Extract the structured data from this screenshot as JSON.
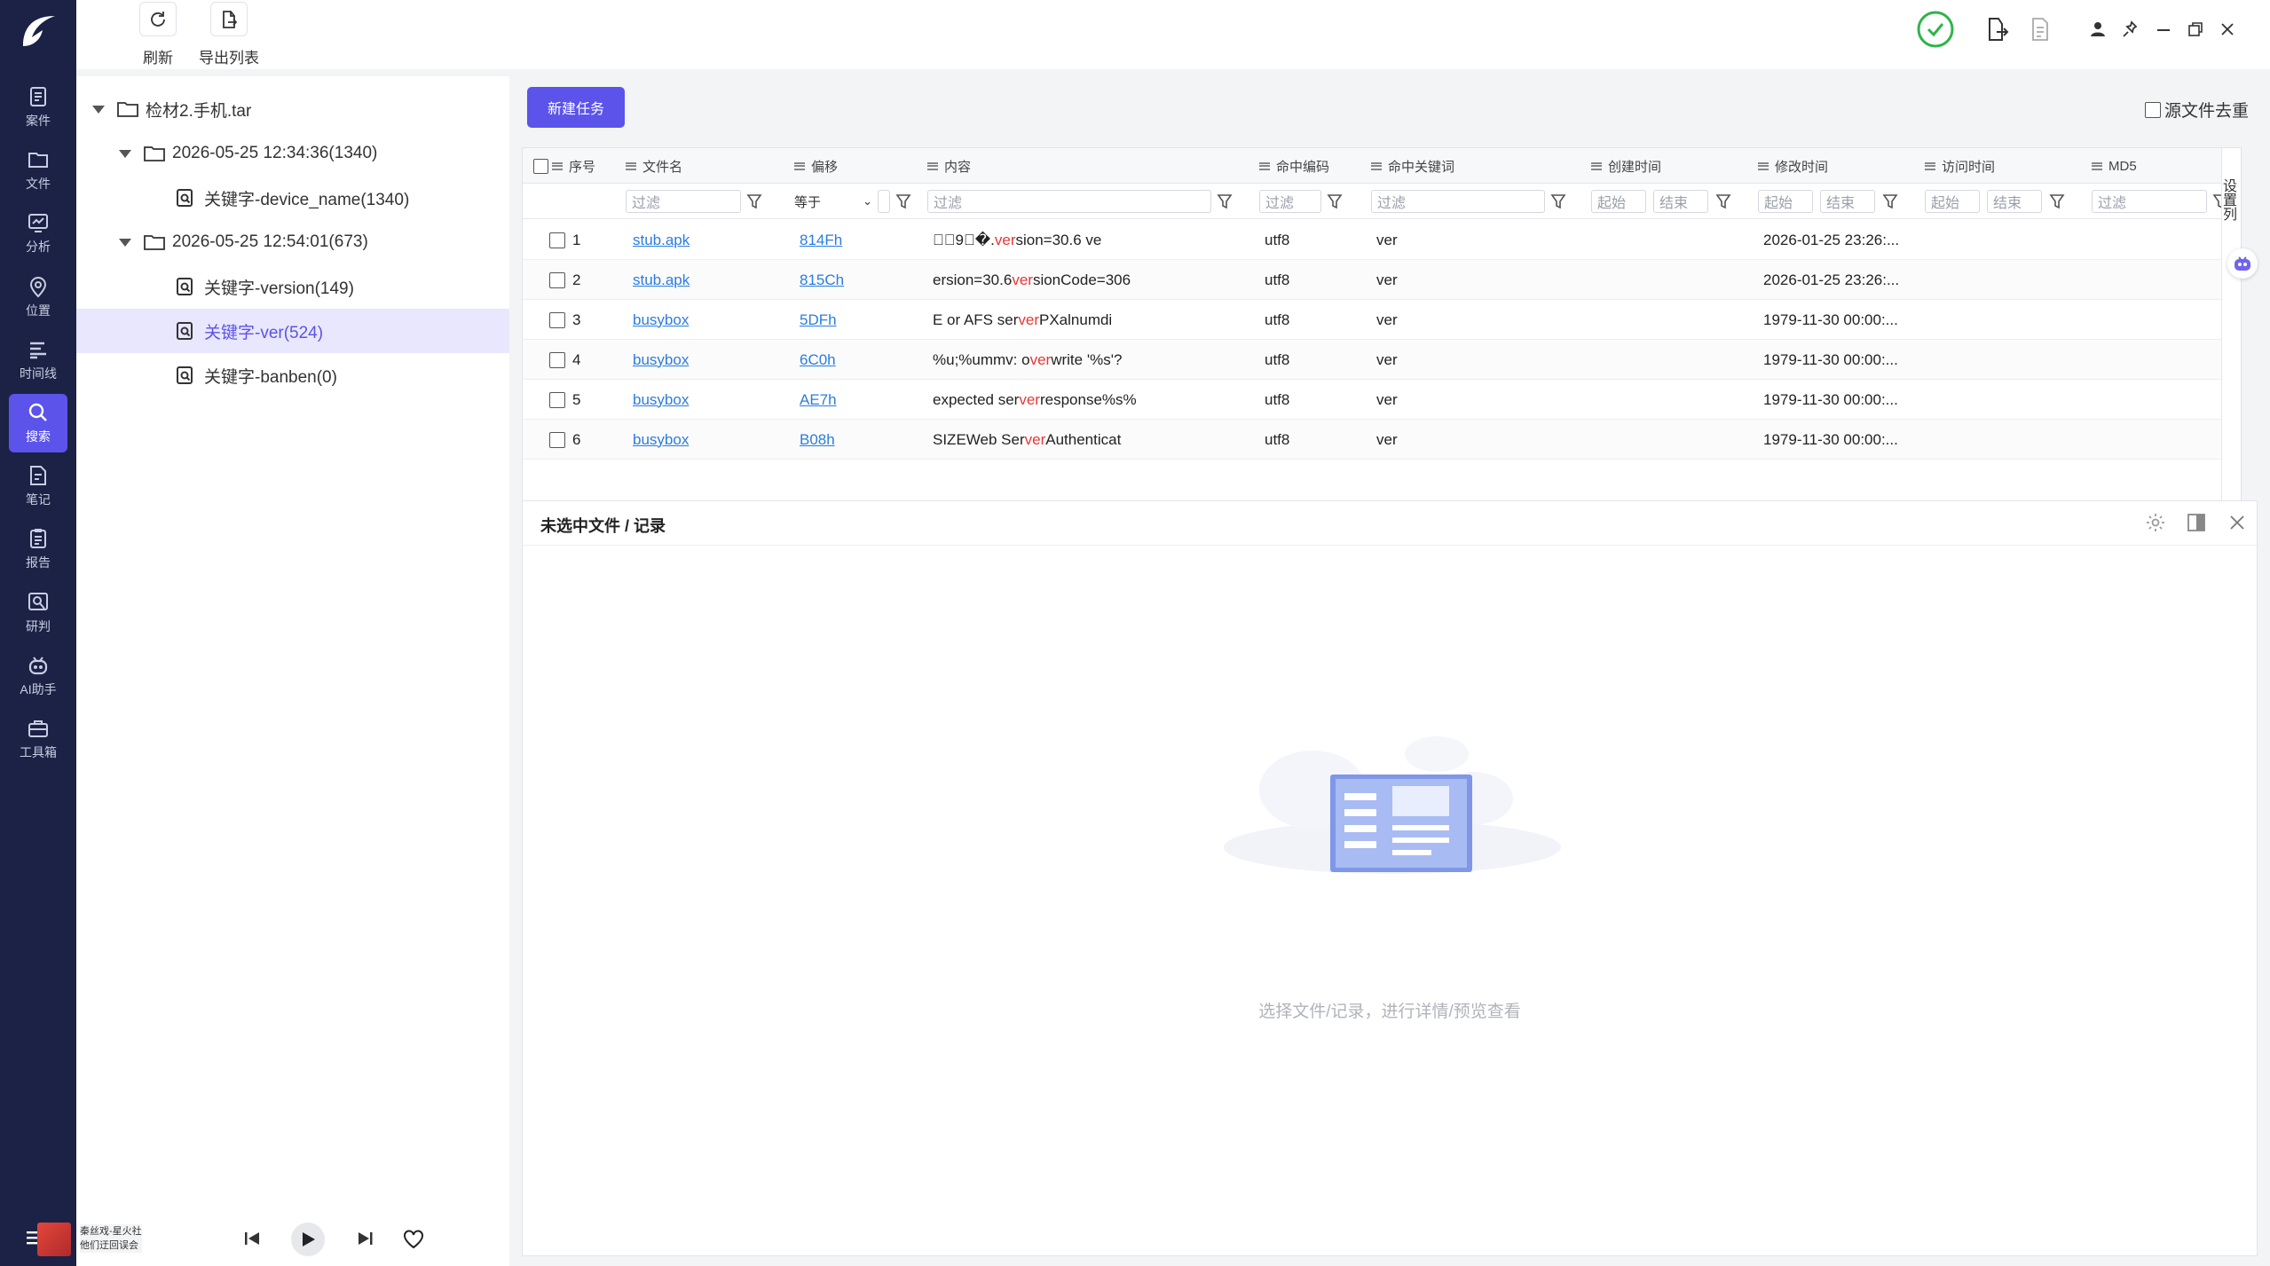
{
  "nav": {
    "items": [
      {
        "label": "案件",
        "icon": "case-icon"
      },
      {
        "label": "文件",
        "icon": "folder-icon"
      },
      {
        "label": "分析",
        "icon": "analysis-icon"
      },
      {
        "label": "位置",
        "icon": "location-pin-icon"
      },
      {
        "label": "时间线",
        "icon": "timeline-icon"
      },
      {
        "label": "搜索",
        "icon": "search-icon"
      },
      {
        "label": "笔记",
        "icon": "note-icon"
      },
      {
        "label": "报告",
        "icon": "report-icon"
      },
      {
        "label": "研判",
        "icon": "judgement-icon"
      },
      {
        "label": "AI助手",
        "icon": "ai-robot-icon"
      },
      {
        "label": "工具箱",
        "icon": "toolbox-icon"
      }
    ],
    "active": "搜索",
    "accent": "#5b53ea"
  },
  "toolbar": {
    "refresh_label": "刷新",
    "export_label": "导出列表"
  },
  "tree": {
    "root": "检材2.手机.tar",
    "nodes": [
      {
        "label": "2026-05-25 12:34:36(1340)"
      },
      {
        "label": "关键字-device_name(1340)"
      },
      {
        "label": "2026-05-25 12:54:01(673)"
      },
      {
        "label": "关键字-version(149)"
      },
      {
        "label": "关键字-ver(524)"
      },
      {
        "label": "关键字-banben(0)"
      }
    ]
  },
  "music": {
    "line1": "秦丝戏-星火社",
    "line2": "他们迂回误会"
  },
  "main": {
    "new_task_label": "新建任务",
    "dedup_label": "源文件去重",
    "columns": [
      "序号",
      "文件名",
      "偏移",
      "内容",
      "命中编码",
      "命中关键词",
      "创建时间",
      "修改时间",
      "访问时间",
      "MD5"
    ],
    "filter": {
      "placeholder": "过滤",
      "equals": "等于",
      "start": "起始",
      "end": "结束"
    },
    "rows": [
      {
        "idx": "1",
        "file": "stub.apk",
        "offset": "814Fh",
        "pre": "\u0000\u00019\u0002�.",
        "hit": "ver",
        "post": "sion=30.6 ve",
        "enc": "utf8",
        "kw": "ver",
        "mtime": "2026-01-25 23:26:..."
      },
      {
        "idx": "2",
        "file": "stub.apk",
        "offset": "815Ch",
        "pre": "ersion=30.6 ",
        "hit": "ver",
        "post": "sionCode=306",
        "enc": "utf8",
        "kw": "ver",
        "mtime": "2026-01-25 23:26:..."
      },
      {
        "idx": "3",
        "file": "busybox",
        "offset": "5DFh",
        "pre": "E or AFS ser",
        "hit": "ver",
        "post": "PXalnumdi",
        "enc": "utf8",
        "kw": "ver",
        "mtime": "1979-11-30 00:00:..."
      },
      {
        "idx": "4",
        "file": "busybox",
        "offset": "6C0h",
        "pre": "%u;%ummv: o",
        "hit": "ver",
        "post": "write '%s'?",
        "enc": "utf8",
        "kw": "ver",
        "mtime": "1979-11-30 00:00:..."
      },
      {
        "idx": "5",
        "file": "busybox",
        "offset": "AE7h",
        "pre": "expected ser",
        "hit": "ver",
        "post": " response%s%",
        "enc": "utf8",
        "kw": "ver",
        "mtime": "1979-11-30 00:00:..."
      },
      {
        "idx": "6",
        "file": "busybox",
        "offset": "B08h",
        "pre": "SIZEWeb Ser",
        "hit": "ver",
        "post": " Authenticat",
        "enc": "utf8",
        "kw": "ver",
        "mtime": "1979-11-30 00:00:..."
      }
    ],
    "side_tab": "设置列"
  },
  "detail": {
    "title": "未选中文件 / 记录",
    "placeholder_text": "选择文件/记录，进行详情/预览查看"
  }
}
